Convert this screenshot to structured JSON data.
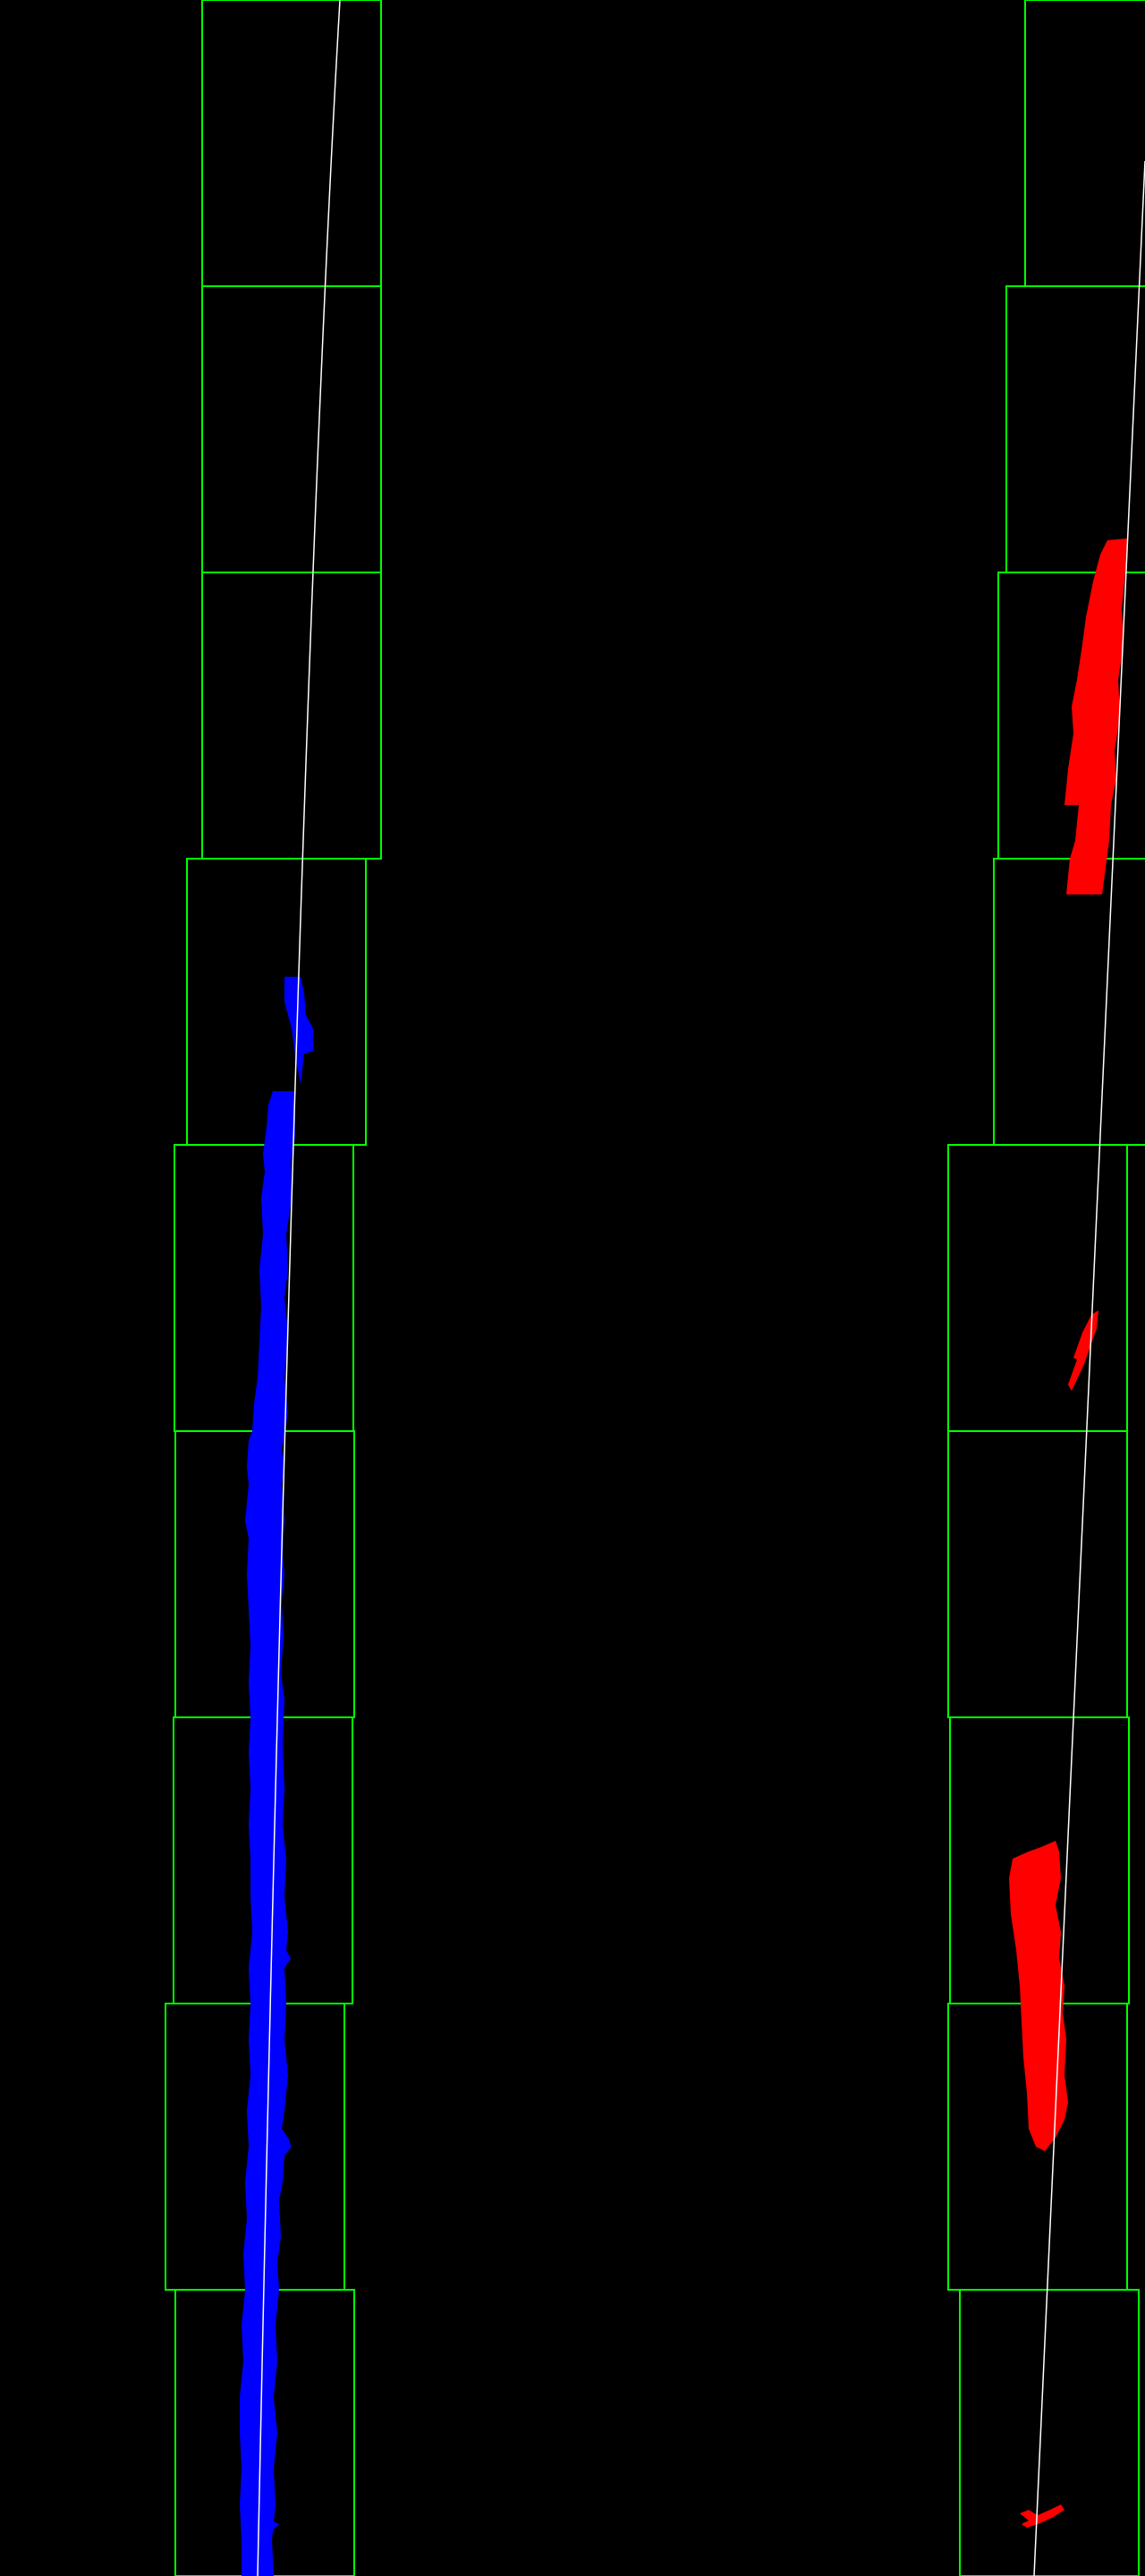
{
  "title": "",
  "colors": {
    "background": "#000000",
    "window_outline": "#00ff00",
    "left_lane_pixels": "#0000ff",
    "right_lane_pixels": "#ff0000",
    "fitted_polyline": "#ffffff"
  },
  "sliding_windows": {
    "count_per_lane": 9,
    "lanes": [
      "left",
      "right"
    ]
  }
}
